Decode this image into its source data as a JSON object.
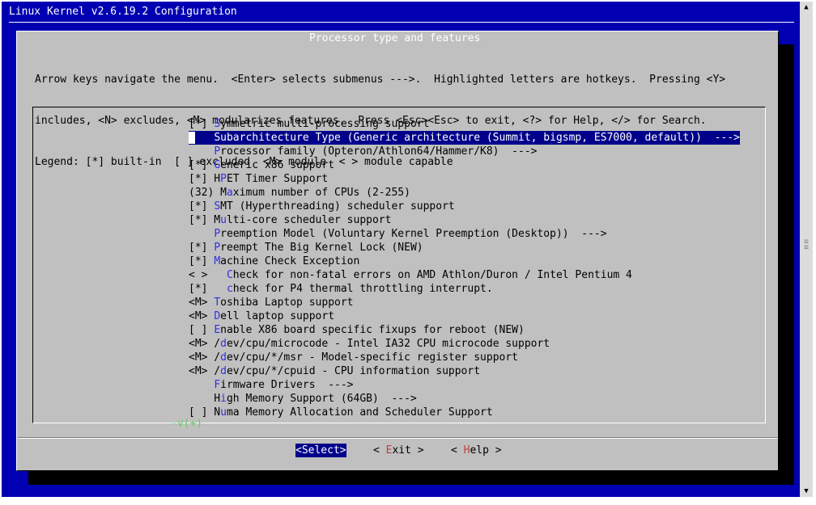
{
  "window": {
    "title": "Linux Kernel v2.6.19.2 Configuration"
  },
  "dialog": {
    "title": "Processor type and features",
    "help_lines": [
      "Arrow keys navigate the menu.  <Enter> selects submenus --->.  Highlighted letters are hotkeys.  Pressing <Y>",
      "includes, <N> excludes, <M> modularizes features.  Press <Esc><Esc> to exit, <?> for Help, </> for Search.",
      "Legend: [*] built-in  [ ] excluded  <M> module  < > module capable"
    ],
    "more_indicator": "-v(+)"
  },
  "menu": {
    "items": [
      {
        "prefix": "[*] ",
        "hotkey": "S",
        "rest": "ymmetric multi-processing support",
        "selected": false
      },
      {
        "prefix": "    ",
        "hotkey": "S",
        "rest": "ubarchitecture Type (Generic architecture (Summit, bigsmp, ES7000, default))  --->",
        "selected": true
      },
      {
        "prefix": "    ",
        "hotkey": "P",
        "rest": "rocessor family (Opteron/Athlon64/Hammer/K8)  --->",
        "selected": false
      },
      {
        "prefix": "[*] ",
        "hotkey": "G",
        "rest": "eneric x86 support",
        "selected": false
      },
      {
        "prefix": "[*] H",
        "hotkey": "P",
        "rest": "ET Timer Support",
        "selected": false
      },
      {
        "prefix": "(32) M",
        "hotkey": "a",
        "rest": "ximum number of CPUs (2-255)",
        "selected": false
      },
      {
        "prefix": "[*] ",
        "hotkey": "S",
        "rest": "MT (Hyperthreading) scheduler support",
        "selected": false
      },
      {
        "prefix": "[*] M",
        "hotkey": "u",
        "rest": "lti-core scheduler support",
        "selected": false
      },
      {
        "prefix": "    ",
        "hotkey": "P",
        "rest": "reemption Model (Voluntary Kernel Preemption (Desktop))  --->",
        "selected": false
      },
      {
        "prefix": "[*] ",
        "hotkey": "P",
        "rest": "reempt The Big Kernel Lock (NEW)",
        "selected": false
      },
      {
        "prefix": "[*] ",
        "hotkey": "M",
        "rest": "achine Check Exception",
        "selected": false
      },
      {
        "prefix": "< >   ",
        "hotkey": "C",
        "rest": "heck for non-fatal errors on AMD Athlon/Duron / Intel Pentium 4",
        "selected": false
      },
      {
        "prefix": "[*]   ",
        "hotkey": "c",
        "rest": "heck for P4 thermal throttling interrupt.",
        "selected": false
      },
      {
        "prefix": "<M> ",
        "hotkey": "T",
        "rest": "oshiba Laptop support",
        "selected": false
      },
      {
        "prefix": "<M> ",
        "hotkey": "D",
        "rest": "ell laptop support",
        "selected": false
      },
      {
        "prefix": "[ ] ",
        "hotkey": "E",
        "rest": "nable X86 board specific fixups for reboot (NEW)",
        "selected": false
      },
      {
        "prefix": "<M> /",
        "hotkey": "d",
        "rest": "ev/cpu/microcode - Intel IA32 CPU microcode support",
        "selected": false
      },
      {
        "prefix": "<M> /",
        "hotkey": "d",
        "rest": "ev/cpu/*/msr - Model-specific register support",
        "selected": false
      },
      {
        "prefix": "<M> /",
        "hotkey": "d",
        "rest": "ev/cpu/*/cpuid - CPU information support",
        "selected": false
      },
      {
        "prefix": "    ",
        "hotkey": "F",
        "rest": "irmware Drivers  --->",
        "selected": false
      },
      {
        "prefix": "    H",
        "hotkey": "i",
        "rest": "gh Memory Support (64GB)  --->",
        "selected": false
      },
      {
        "prefix": "[ ] N",
        "hotkey": "u",
        "rest": "ma Memory Allocation and Scheduler Support",
        "selected": false
      }
    ]
  },
  "buttons": {
    "select": "<Select>",
    "exit_pre": "< ",
    "exit_hotkey": "E",
    "exit_post": "xit >",
    "help_pre": "< ",
    "help_hotkey": "H",
    "help_post": "elp >"
  },
  "scrollbar": {
    "up_icon": "▲",
    "down_icon": "▼"
  },
  "colors": {
    "background": "#0000b2",
    "dialog": "#c0c0c0",
    "highlight": "#00008b"
  }
}
